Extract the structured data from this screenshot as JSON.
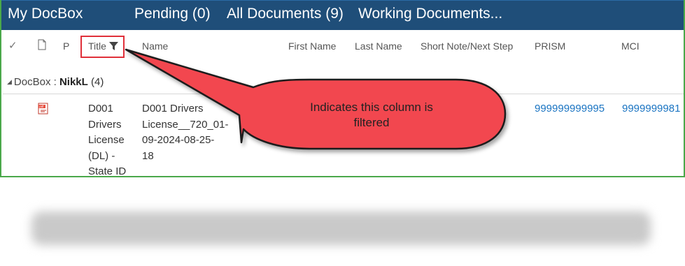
{
  "nav": {
    "brand": "My DocBox",
    "pending": "Pending (0)",
    "all_documents": "All Documents (9)",
    "working_documents": "Working Documents..."
  },
  "columns": {
    "check": "✓",
    "doc_icon": "document-icon",
    "p": "P",
    "title": "Title",
    "name": "Name",
    "first_name": "First Name",
    "last_name": "Last Name",
    "short_note": "Short Note/Next Step",
    "prism": "PRISM",
    "mci": "MCI"
  },
  "group": {
    "label": "DocBox :",
    "value": "NikkL",
    "count": "(4)"
  },
  "row": {
    "icon": "pdf-icon",
    "title_lines": [
      "D001",
      "Drivers",
      "License",
      "(DL) -",
      "State ID"
    ],
    "name_lines": [
      "D001 Drivers",
      "License__720_01-",
      "09-2024-08-25-",
      "18"
    ],
    "prism": "999999999995",
    "mci": "9999999981"
  },
  "callout": {
    "line1": "Indicates this column is",
    "line2": "filtered",
    "fill": "#f2474f",
    "stroke": "#1a1a1a"
  },
  "colors": {
    "topbar": "#1f4e79",
    "frame_border": "#4aa84a",
    "link": "#1a74c2",
    "highlight_box": "#e0303a"
  }
}
